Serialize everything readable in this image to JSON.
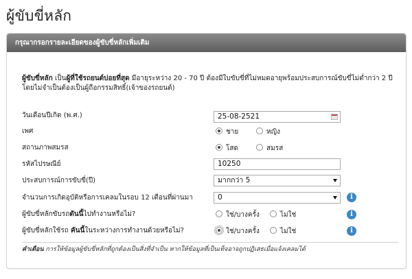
{
  "page": {
    "title": "ผู้ขับขี่หลัก"
  },
  "card": {
    "header": "กรุณากรอกรายละเอียดของผู้ขับขี่หลักเพิ่มเติม"
  },
  "intro": {
    "bold_lead": "ผู้ขับขี่หลัก",
    "text_1": " เป็น",
    "bold_mid": "ผู้ที่ใช้รถยนต์บ่อยที่สุด",
    "text_2": " มีอายุระหว่าง 20 - 70 ปี ต้องมีใบขับขี่ที่ไม่หมดอายุพร้อมประสบการณ์ขับขี่ไม่ต่ำกว่า 2 ปี โดยไม่จำเป็นต้องเป็นผู้ถือกรรมสิทธิ์(เจ้าของรถยนต์)"
  },
  "form": {
    "dob": {
      "label": "วันเดือนปีเกิด (พ.ศ.)",
      "value": "25-08-2521"
    },
    "gender": {
      "label": "เพศ",
      "options": [
        "ชาย",
        "หญิง"
      ],
      "selected": "ชาย"
    },
    "marital": {
      "label": "สถานภาพสมรส",
      "options": [
        "โสด",
        "สมรส"
      ],
      "selected": "โสด"
    },
    "postcode": {
      "label": "รหัสไปรษณีย์",
      "value": "10250"
    },
    "experience": {
      "label": "ประสบการณ์การขับขี่(ปี)",
      "value": "มากกว่า 5"
    },
    "claims": {
      "label": "จำนวนการเกิดอุบัติหรือการเคลมในรอบ 12 เดือนที่ผ่านมา",
      "value": "0"
    },
    "commute": {
      "label_pre": "ผู้ขับขี่หลักขับรถ",
      "label_bold": "ดันนี้",
      "label_post": "ไปทำงานหรือไม่?",
      "options": [
        "ใช่/บางครั้ง",
        "ไม่ใช่"
      ],
      "selected": ""
    },
    "work_use": {
      "label_pre": "ผู้ขับขี่หลักใช้รถ ",
      "label_bold": "คันนี้",
      "label_post": "ในระหว่างการทำงานด้วยหรือไม่?",
      "options": [
        "ใช่/บางครั้ง",
        "ไม่ใช่"
      ],
      "selected": "ใช่/บางครั้ง"
    }
  },
  "warning": {
    "bold": "คำเตือน",
    "text": " การให้ข้อมูลผู้ขับขี่หลักที่ถูกต้องเป็นสิ่งที่จำเป็น หากให้ข้อมูลที่เป็นเท็จอาจถูกปฏิเสธเมื่อแจ้งเคลมได้"
  },
  "icons": {
    "info": "info-icon",
    "calendar": "calendar-icon",
    "dropdown": "chevron-down-icon"
  },
  "colors": {
    "header_bg": "#6f6f6f",
    "info_blue": "#3d86c6"
  }
}
